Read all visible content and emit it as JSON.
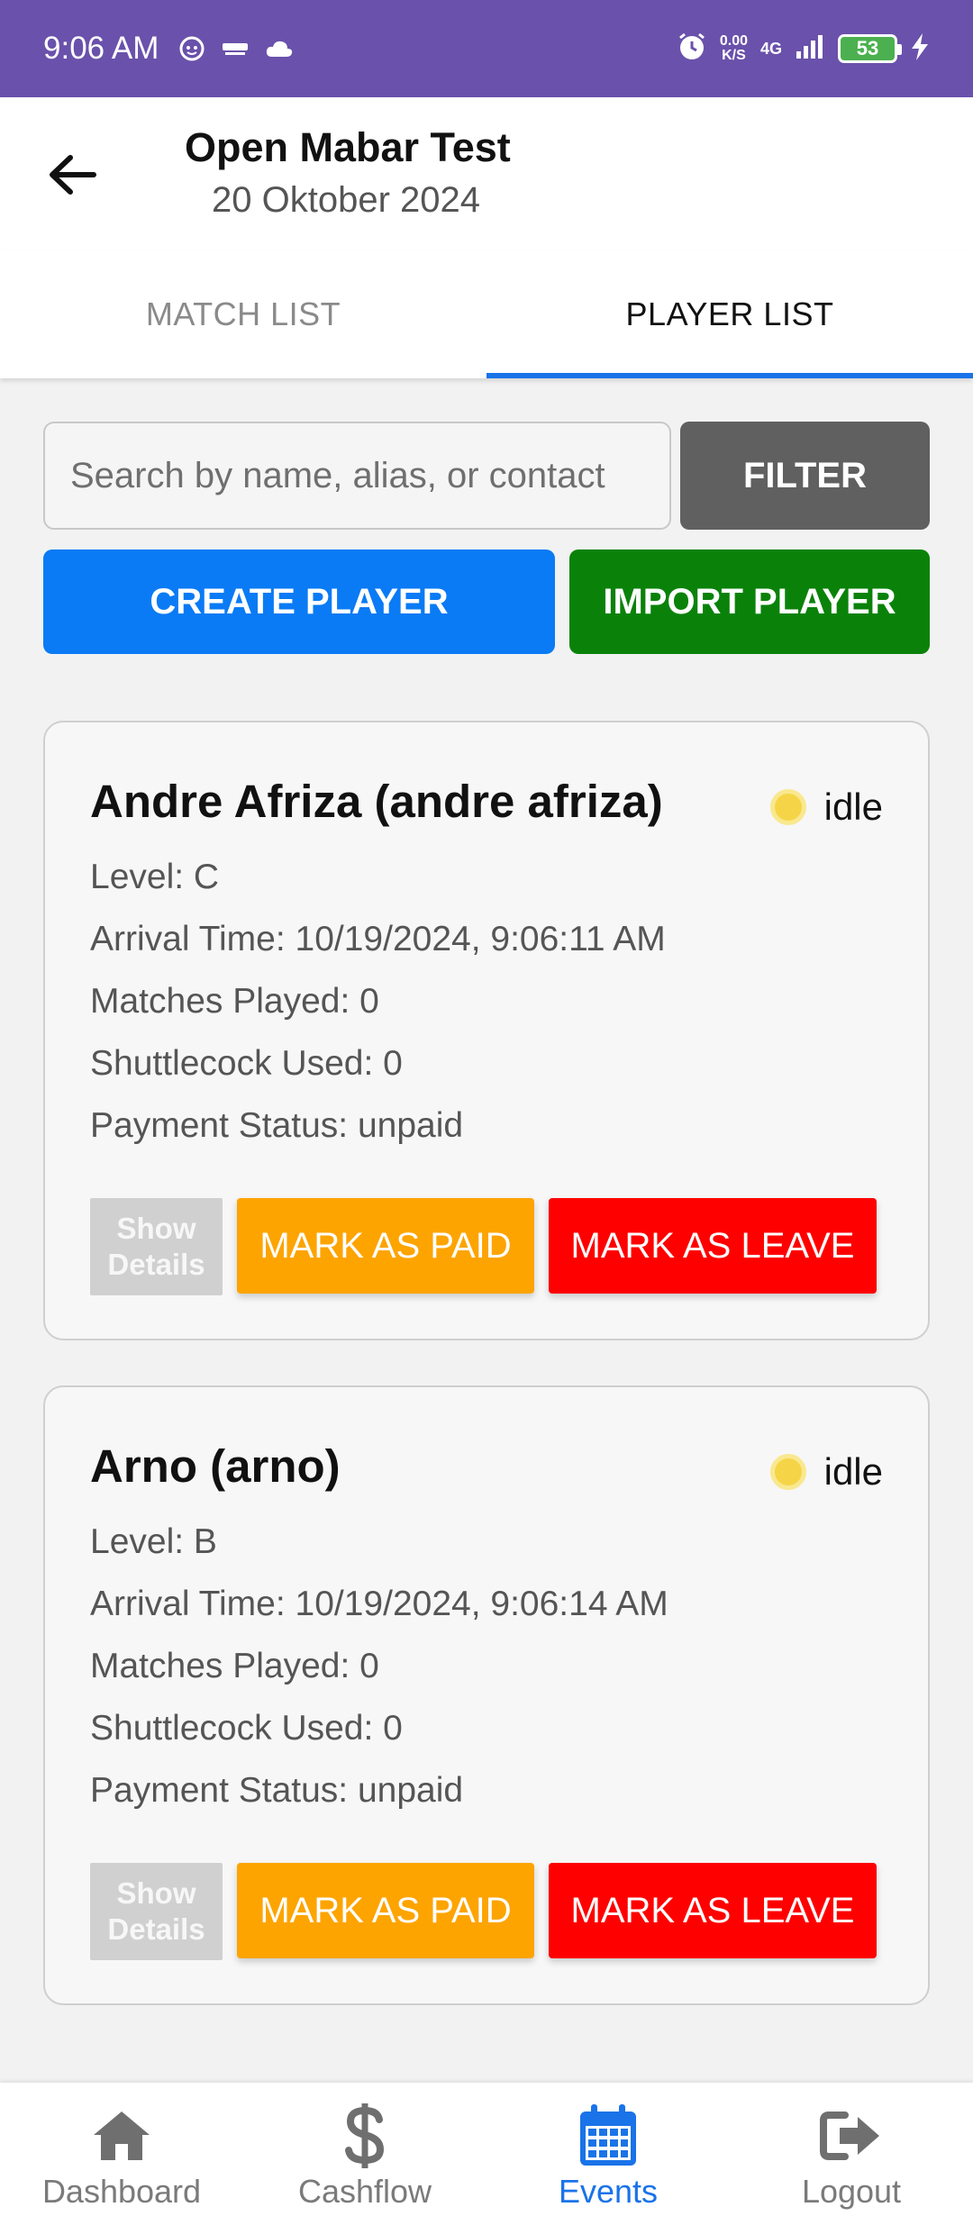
{
  "status_bar": {
    "time": "9:06 AM",
    "net_speed_value": "0.00",
    "net_speed_unit": "K/S",
    "network": "4G",
    "battery": "53"
  },
  "header": {
    "title": "Open Mabar Test",
    "date": "20 Oktober 2024"
  },
  "tabs": [
    {
      "label": "MATCH LIST",
      "active": false
    },
    {
      "label": "PLAYER LIST",
      "active": true
    }
  ],
  "search": {
    "placeholder": "Search by name, alias, or contact",
    "value": ""
  },
  "buttons": {
    "filter": "FILTER",
    "create_player": "CREATE PLAYER",
    "import_player": "IMPORT PLAYER"
  },
  "players": [
    {
      "name": "Andre Afriza (andre afriza)",
      "status": "idle",
      "level": "Level: C",
      "arrival": "Arrival Time: 10/19/2024, 9:06:11 AM",
      "matches": "Matches Played: 0",
      "shuttlecock": "Shuttlecock Used: 0",
      "payment": "Payment Status: unpaid",
      "details_line1": "Show",
      "details_line2": "Details",
      "paid_label": "MARK AS PAID",
      "leave_label": "MARK AS LEAVE"
    },
    {
      "name": "Arno (arno)",
      "status": "idle",
      "level": "Level: B",
      "arrival": "Arrival Time: 10/19/2024, 9:06:14 AM",
      "matches": "Matches Played: 0",
      "shuttlecock": "Shuttlecock Used: 0",
      "payment": "Payment Status: unpaid",
      "details_line1": "Show",
      "details_line2": "Details",
      "paid_label": "MARK AS PAID",
      "leave_label": "MARK AS LEAVE"
    }
  ],
  "bottom_nav": [
    {
      "label": "Dashboard",
      "icon": "home-icon",
      "active": false
    },
    {
      "label": "Cashflow",
      "icon": "dollar-icon",
      "active": false
    },
    {
      "label": "Events",
      "icon": "calendar-icon",
      "active": true
    },
    {
      "label": "Logout",
      "icon": "logout-icon",
      "active": false
    }
  ],
  "colors": {
    "status_bar": "#6a51ab",
    "accent": "#1a73e8",
    "filter": "#606060",
    "create": "#0a7bf5",
    "import": "#0a820a",
    "paid": "#fda400",
    "leave": "#ff0000",
    "idle_dot": "#f5d547"
  }
}
